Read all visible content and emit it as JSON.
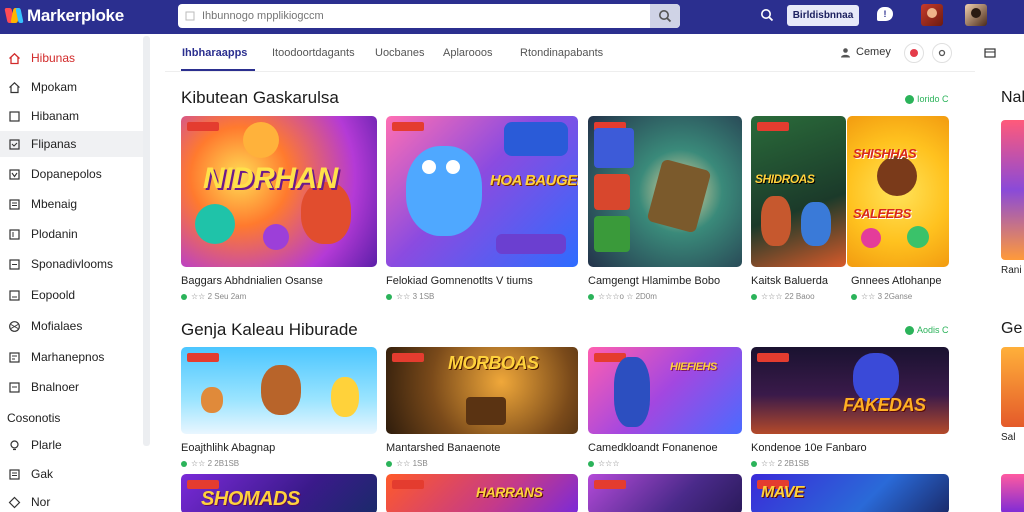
{
  "app": {
    "logo_text": "Markerploke",
    "search_placeholder": "Ihbunnogo mpplikiogccm",
    "sign_in_label": "Birldisbnnaa"
  },
  "sidebar": {
    "items": [
      {
        "label": "Hibunas",
        "icon": "home-icon",
        "active": true
      },
      {
        "label": "Mpokam",
        "icon": "home-outline-icon"
      },
      {
        "label": "Hibanam",
        "icon": "box-icon"
      },
      {
        "label": "Flipanas",
        "icon": "folder-icon",
        "hover": true
      },
      {
        "label": "Dopanepolos",
        "icon": "tag-icon"
      },
      {
        "label": "Mbenaig",
        "icon": "list-icon"
      },
      {
        "label": "Plodanin",
        "icon": "bookmark-icon"
      },
      {
        "label": "Sponadivlooms",
        "icon": "grid-icon"
      },
      {
        "label": "Eopoold",
        "icon": "card-icon"
      },
      {
        "label": "Mofialaes",
        "icon": "globe-icon"
      },
      {
        "label": "Marhanepnos",
        "icon": "doc-icon"
      },
      {
        "label": "Bnalnoer",
        "icon": "page-icon"
      }
    ],
    "section_label": "Cosonotis",
    "extra_items": [
      {
        "label": "Plarle",
        "icon": "bulb-icon"
      },
      {
        "label": "Gak",
        "icon": "list-icon"
      },
      {
        "label": "Nor",
        "icon": "diamond-icon"
      }
    ]
  },
  "tabs": {
    "items": [
      "Ihbharaapps",
      "Itoodoortdagants",
      "Uocbanes",
      "Aplarooos",
      "Rtondinapabants"
    ],
    "active_index": 0,
    "right_label": "Cemey"
  },
  "sections": [
    {
      "title": "Kibutean Gaskarulsa",
      "badge": "Iorido C",
      "cards": [
        {
          "name": "Baggars Abhdnialien Osanse",
          "meta": "☆☆ 2 Seu 2am",
          "art": "NIDRHAN"
        },
        {
          "name": "Felokiad Gomnenotlts V tiums",
          "meta": "☆☆ 3 1SB",
          "art": "HOA BAUGEB"
        },
        {
          "name": "Camgengt Hlamimbe Bobo",
          "meta": "☆☆☆o ☆ 2D0m",
          "art": ""
        },
        {
          "name": "Kaitsk Baluerda",
          "meta": "☆☆☆ 22 Baoo",
          "art": "SHIDROAS"
        },
        {
          "name": "Gnnees Atlohanpe",
          "meta": "☆☆ 3 2Ganse",
          "art": "SHISHHAS SALEEBS"
        }
      ]
    },
    {
      "title": "Genja Kaleau Hiburade",
      "badge": "Aodis C",
      "cards": [
        {
          "name": "Eoajthlihk Abagnap",
          "meta": "☆☆ 2 2B1SB",
          "art": ""
        },
        {
          "name": "Mantarshed Banaenote",
          "meta": "☆☆ 1SB",
          "art": "MORBOAS"
        },
        {
          "name": "Camedkloandt Fonanenoe",
          "meta": "☆☆☆",
          "art": "HIEFIEHS"
        },
        {
          "name": "Kondenoe 10e Fanbaro",
          "meta": "☆☆ 2 2B1SB",
          "art": "FAKEDAS"
        }
      ]
    },
    {
      "cards": [
        {
          "art": "SHOMADS"
        },
        {
          "art": "HARRANS"
        },
        {
          "art": ""
        },
        {
          "art": "MAVE"
        }
      ]
    }
  ],
  "right_column": {
    "titles": [
      "Nal",
      "Ge"
    ],
    "texts": [
      "Rani",
      "Sal"
    ]
  },
  "colors": {
    "topbar": "#2b2f8f",
    "accent": "#2b2f8f",
    "active": "#d22a2a",
    "badge": "#2bb35a"
  }
}
